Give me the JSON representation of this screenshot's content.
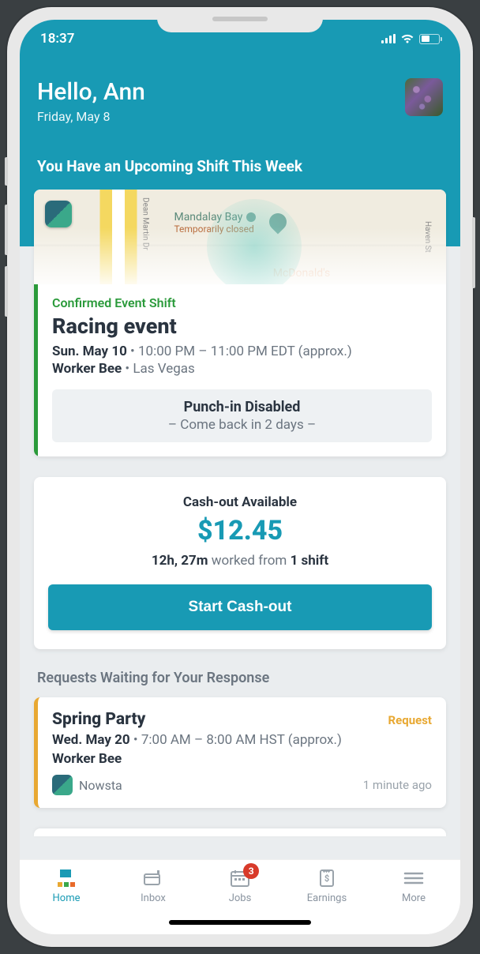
{
  "status_bar": {
    "time": "18:37"
  },
  "header": {
    "greeting": "Hello, Ann",
    "date": "Friday, May 8",
    "upcoming_title": "You Have an Upcoming Shift This Week"
  },
  "map": {
    "venue": "Mandalay Bay",
    "closed": "Temporarily closed",
    "nearby": "McDonald's",
    "street_left": "Dean Martin Dr",
    "street_right": "Haven St"
  },
  "shift": {
    "status": "Confirmed Event Shift",
    "title": "Racing event",
    "date": "Sun. May 10",
    "time_range": "10:00 PM – 11:00 PM EDT (approx.)",
    "role": "Worker Bee",
    "location": "Las Vegas",
    "punch_title": "Punch-in Disabled",
    "punch_sub": "– Come back in 2 days –"
  },
  "cashout": {
    "label": "Cash-out Available",
    "amount": "$12.45",
    "worked_time": "12h, 27m",
    "worked_mid": "worked from",
    "worked_count": "1 shift",
    "button": "Start Cash-out"
  },
  "requests": {
    "heading": "Requests Waiting for Your Response",
    "item": {
      "title": "Spring Party",
      "badge": "Request",
      "date": "Wed. May 20",
      "time_range": "7:00 AM – 8:00 AM HST (approx.)",
      "role": "Worker Bee",
      "org": "Nowsta",
      "age": "1 minute ago"
    }
  },
  "tabs": {
    "home": "Home",
    "inbox": "Inbox",
    "jobs": "Jobs",
    "earnings": "Earnings",
    "more": "More",
    "jobs_badge": "3"
  }
}
